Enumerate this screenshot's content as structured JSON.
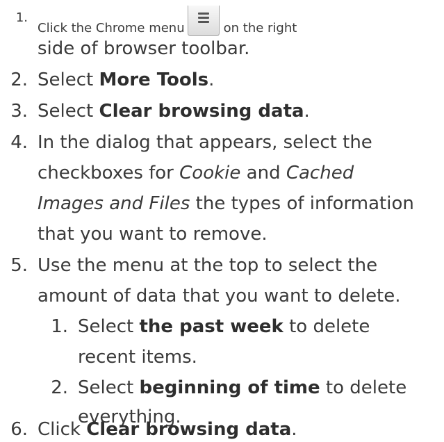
{
  "steps": [
    {
      "number": "1.",
      "before_icon": "Click the Chrome menu",
      "icon": "hamburger-menu-icon",
      "after_icon": "on the right",
      "continuation": "side of browser toolbar."
    },
    {
      "number": "2.",
      "prefix": "Select ",
      "bold": "More Tools",
      "suffix": "."
    },
    {
      "number": "3.",
      "prefix": "Select ",
      "bold": "Clear browsing data",
      "suffix": "."
    },
    {
      "number": "4.",
      "line1": "In the dialog that appears, select the",
      "line2_prefix": "checkboxes for ",
      "line2_italic1": "Cookie",
      "line2_mid": " and ",
      "line2_italic2": "Cached",
      "line3_italic": "Images and Files",
      "line3_suffix": " the types of information",
      "line4": "that you want to remove."
    },
    {
      "number": "5.",
      "line1": "Use the menu at the top to select the",
      "line2": "amount of data that you want to delete.",
      "substeps": [
        {
          "number": "1.",
          "prefix": "Select ",
          "bold": "the past week",
          "suffix": " to delete",
          "continuation": "recent items."
        },
        {
          "number": "2.",
          "prefix": "Select ",
          "bold": "beginning of time",
          "suffix": " to delete",
          "continuation": "everything."
        }
      ]
    },
    {
      "number": "6.",
      "prefix": "Click ",
      "bold": "Clear browsing data",
      "suffix": "."
    }
  ]
}
